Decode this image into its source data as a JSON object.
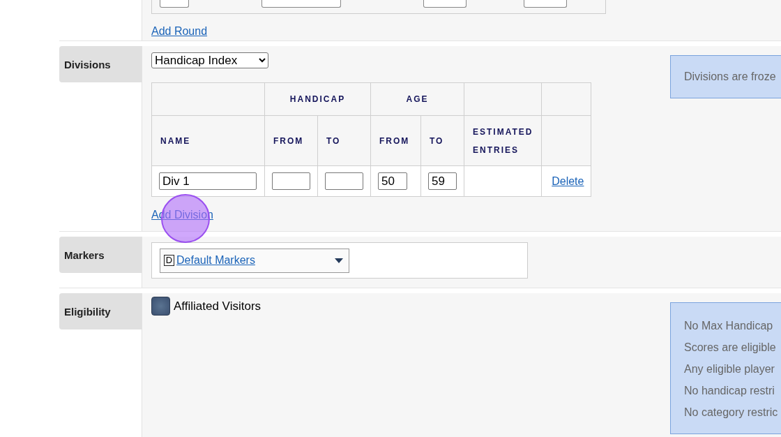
{
  "rounds": {
    "add_link": "Add Round"
  },
  "divisions": {
    "label": "Divisions",
    "type_select": "Handicap Index",
    "group_headers": [
      "HANDICAP",
      "AGE"
    ],
    "columns": [
      "NAME",
      "FROM",
      "TO",
      "FROM",
      "TO",
      "ESTIMATED ENTRIES"
    ],
    "rows": [
      {
        "name": "Div 1",
        "age_from": "50",
        "age_to": "59",
        "action": "Delete"
      }
    ],
    "add_link": "Add Division",
    "notice": "Divisions are froze"
  },
  "markers": {
    "label": "Markers",
    "badge": "D",
    "marker": "Default Markers"
  },
  "eligibility": {
    "label": "Eligibility",
    "options": [
      {
        "label": "Affiliated Visitors",
        "checked": true
      }
    ],
    "notes": [
      "No Max Handicap",
      "Scores are eligible",
      "Any eligible player",
      "No handicap restri",
      "No category restric"
    ]
  }
}
